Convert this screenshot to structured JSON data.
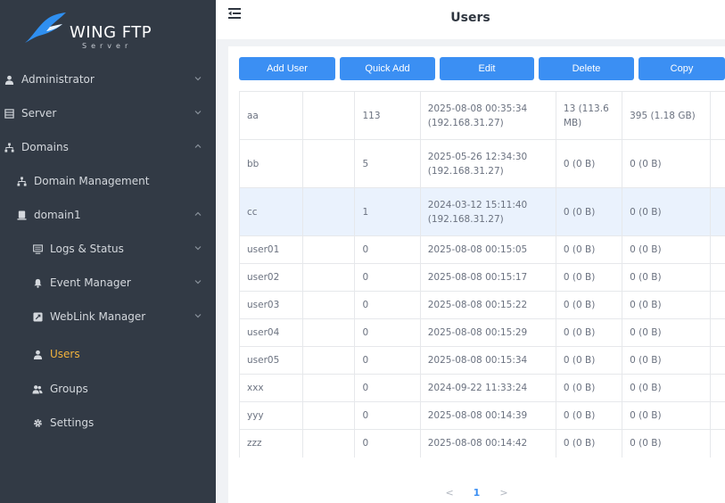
{
  "brand": {
    "name": "WING FTP",
    "sub": "Server"
  },
  "header": {
    "title": "Users"
  },
  "sidebar": {
    "items": [
      {
        "label": "Administrator"
      },
      {
        "label": "Server"
      },
      {
        "label": "Domains"
      },
      {
        "label": "Domain Management"
      },
      {
        "label": "domain1"
      },
      {
        "label": "Logs & Status"
      },
      {
        "label": "Event Manager"
      },
      {
        "label": "WebLink Manager"
      },
      {
        "label": "Users"
      },
      {
        "label": "Groups"
      },
      {
        "label": "Settings"
      }
    ]
  },
  "toolbar": {
    "add_user": "Add User",
    "quick_add": "Quick Add",
    "edit": "Edit",
    "delete": "Delete",
    "copy": "Copy"
  },
  "users": {
    "rows": [
      {
        "name": "aa",
        "logins": "113",
        "last_login": "2025-08-08 00:35:34",
        "last_ip": "(192.168.31.27)",
        "upload": "13 (113.6 MB)",
        "download": "395 (1.18 GB)"
      },
      {
        "name": "bb",
        "logins": "5",
        "last_login": "2025-05-26 12:34:30",
        "last_ip": "(192.168.31.27)",
        "upload": "0 (0 B)",
        "download": "0 (0 B)"
      },
      {
        "name": "cc",
        "logins": "1",
        "last_login": "2024-03-12 15:11:40",
        "last_ip": "(192.168.31.27)",
        "upload": "0 (0 B)",
        "download": "0 (0 B)"
      },
      {
        "name": "user01",
        "logins": "0",
        "last_login": "2025-08-08 00:15:05",
        "last_ip": "",
        "upload": "0 (0 B)",
        "download": "0 (0 B)"
      },
      {
        "name": "user02",
        "logins": "0",
        "last_login": "2025-08-08 00:15:17",
        "last_ip": "",
        "upload": "0 (0 B)",
        "download": "0 (0 B)"
      },
      {
        "name": "user03",
        "logins": "0",
        "last_login": "2025-08-08 00:15:22",
        "last_ip": "",
        "upload": "0 (0 B)",
        "download": "0 (0 B)"
      },
      {
        "name": "user04",
        "logins": "0",
        "last_login": "2025-08-08 00:15:29",
        "last_ip": "",
        "upload": "0 (0 B)",
        "download": "0 (0 B)"
      },
      {
        "name": "user05",
        "logins": "0",
        "last_login": "2025-08-08 00:15:34",
        "last_ip": "",
        "upload": "0 (0 B)",
        "download": "0 (0 B)"
      },
      {
        "name": "xxx",
        "logins": "0",
        "last_login": "2024-09-22 11:33:24",
        "last_ip": "",
        "upload": "0 (0 B)",
        "download": "0 (0 B)"
      },
      {
        "name": "yyy",
        "logins": "0",
        "last_login": "2025-08-08 00:14:39",
        "last_ip": "",
        "upload": "0 (0 B)",
        "download": "0 (0 B)"
      },
      {
        "name": "zzz",
        "logins": "0",
        "last_login": "2025-08-08 00:14:42",
        "last_ip": "",
        "upload": "0 (0 B)",
        "download": "0 (0 B)"
      }
    ]
  },
  "pagination": {
    "prev": "<",
    "current": "1",
    "next": ">"
  },
  "colors": {
    "sidebar_bg": "#323a45",
    "accent": "#3b8ff3",
    "active": "#f2b33d",
    "highlight_row": "#eaf2fd"
  },
  "icons": {
    "administrator": "user-icon",
    "server": "server-icon",
    "domains": "sitemap-icon",
    "domain_management": "sitemap-icon",
    "domain1": "database-icon",
    "logs": "monitor-icon",
    "events": "bell-icon",
    "weblink": "link-icon",
    "users": "user-icon",
    "groups": "users-icon",
    "settings": "gear-icon",
    "menu": "menu-fold-icon"
  }
}
